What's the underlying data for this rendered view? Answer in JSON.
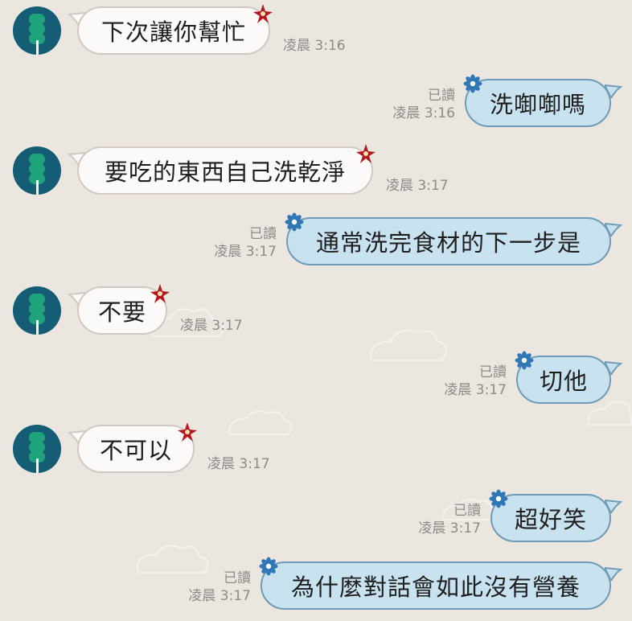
{
  "messages": [
    {
      "side": "in",
      "text": "下次讓你幫忙",
      "time": "凌晨 3:16"
    },
    {
      "side": "out",
      "text": "洗啣啣嗎",
      "read": "已讀",
      "time": "凌晨 3:16"
    },
    {
      "side": "in",
      "text": "要吃的東西自己洗乾淨",
      "time": "凌晨 3:17"
    },
    {
      "side": "out",
      "text": "通常洗完食材的下一步是",
      "read": "已讀",
      "time": "凌晨 3:17"
    },
    {
      "side": "in",
      "text": "不要",
      "time": "凌晨 3:17"
    },
    {
      "side": "out",
      "text": "切他",
      "read": "已讀",
      "time": "凌晨 3:17"
    },
    {
      "side": "in",
      "text": "不可以",
      "time": "凌晨 3:17"
    },
    {
      "side": "out",
      "text": "超好笑",
      "read": "已讀",
      "time": "凌晨 3:17"
    },
    {
      "side": "out",
      "text": "為什麼對話會如此沒有營養",
      "read": "已讀",
      "time": "凌晨 3:17"
    }
  ],
  "colors": {
    "background": "#ece6e1",
    "incoming_bubble": "#fbfaf8",
    "outgoing_bubble": "#c8e2f0",
    "avatar_bg": "#155d74",
    "avatar_ball": "#1fa37a",
    "flower_red": "#b5161b",
    "flower_blue": "#2f77b6"
  },
  "icons": [
    "avatar-dango-icon",
    "red-flower-icon",
    "blue-flower-icon",
    "cloud-decoration-icon"
  ]
}
